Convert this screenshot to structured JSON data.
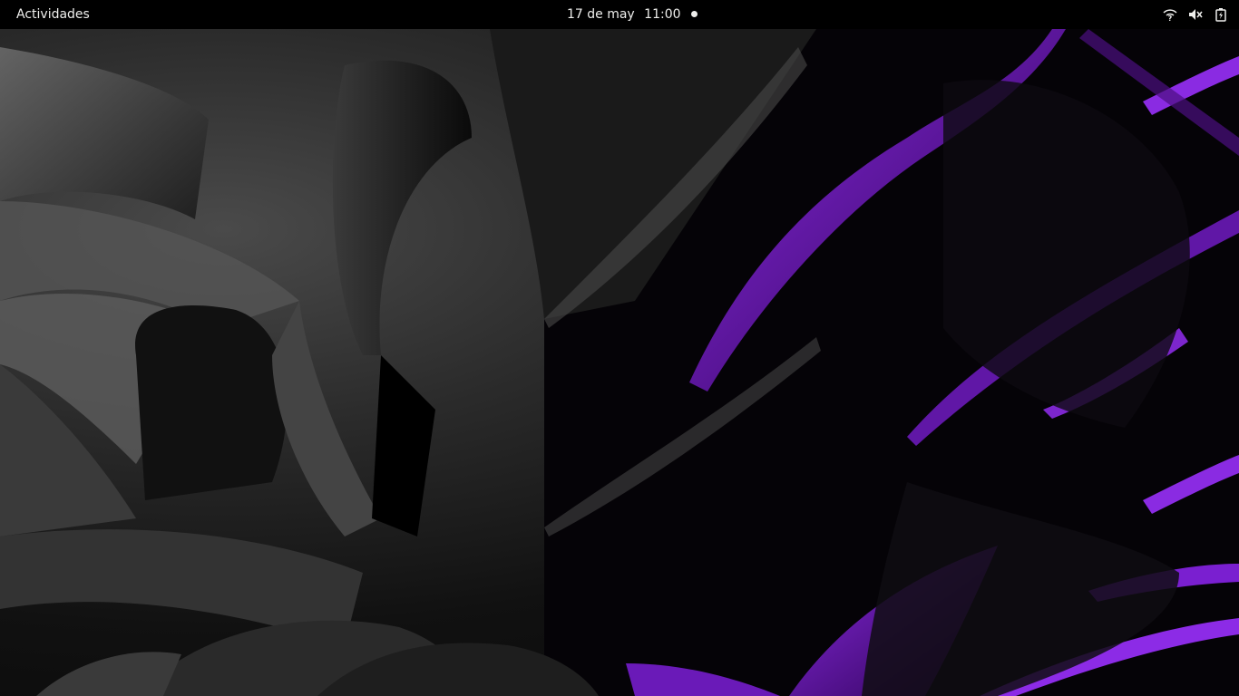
{
  "topbar": {
    "activities_label": "Actividades",
    "date": "17 de may",
    "time": "11:00"
  },
  "system_tray": {
    "icons": [
      "wifi-question-icon",
      "volume-muted-icon",
      "battery-charging-icon"
    ]
  },
  "colors": {
    "panel_bg": "#000000",
    "panel_text": "#eeeeec",
    "wallpaper_accent": "#7a1fd0"
  }
}
